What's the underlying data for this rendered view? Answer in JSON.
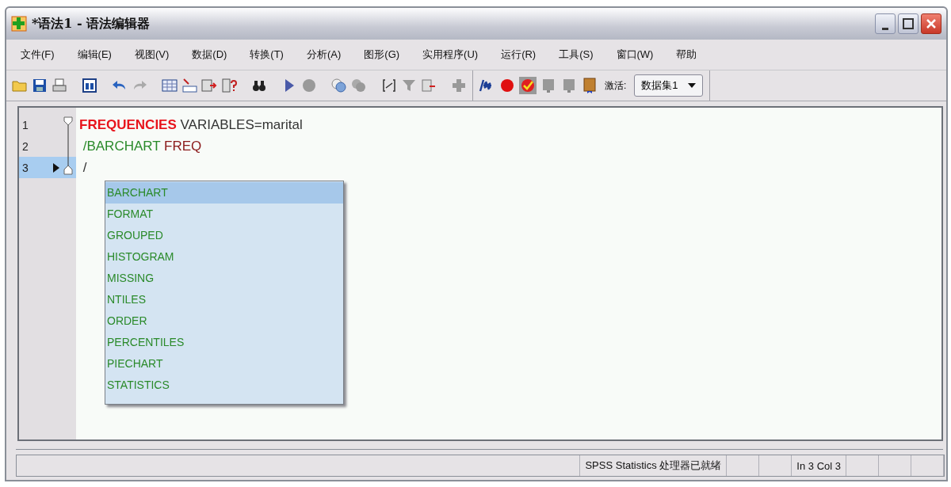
{
  "window": {
    "title": "*语法1 - 语法编辑器"
  },
  "menu": [
    {
      "label": "文件(F)"
    },
    {
      "label": "编辑(E)"
    },
    {
      "label": "视图(V)"
    },
    {
      "label": "数据(D)"
    },
    {
      "label": "转换(T)"
    },
    {
      "label": "分析(A)"
    },
    {
      "label": "图形(G)"
    },
    {
      "label": "实用程序(U)"
    },
    {
      "label": "运行(R)"
    },
    {
      "label": "工具(S)"
    },
    {
      "label": "窗口(W)"
    },
    {
      "label": "帮助"
    }
  ],
  "toolbar": {
    "active_label": "激活:",
    "dataset": "数据集1"
  },
  "editor": {
    "lines": [
      {
        "number": "1",
        "selected": false,
        "tokens": [
          {
            "kind": "command",
            "text": "FREQUENCIES"
          },
          {
            "kind": "plain",
            "text": " VARIABLES=marital"
          }
        ]
      },
      {
        "number": "2",
        "selected": false,
        "tokens": [
          {
            "kind": "subcommand",
            "text": " /BARCHART"
          },
          {
            "kind": "keyword",
            "text": " FREQ"
          }
        ]
      },
      {
        "number": "3",
        "selected": true,
        "tokens": [
          {
            "kind": "plain",
            "text": " /"
          }
        ]
      }
    ],
    "autocomplete": [
      {
        "label": "BARCHART",
        "selected": true
      },
      {
        "label": "FORMAT",
        "selected": false
      },
      {
        "label": "GROUPED",
        "selected": false
      },
      {
        "label": "HISTOGRAM",
        "selected": false
      },
      {
        "label": "MISSING",
        "selected": false
      },
      {
        "label": "NTILES",
        "selected": false
      },
      {
        "label": "ORDER",
        "selected": false
      },
      {
        "label": "PERCENTILES",
        "selected": false
      },
      {
        "label": "PIECHART",
        "selected": false
      },
      {
        "label": "STATISTICS",
        "selected": false
      }
    ]
  },
  "status_bar": {
    "message": "SPSS Statistics  处理器已就绪",
    "position": "In 3 Col 3"
  }
}
